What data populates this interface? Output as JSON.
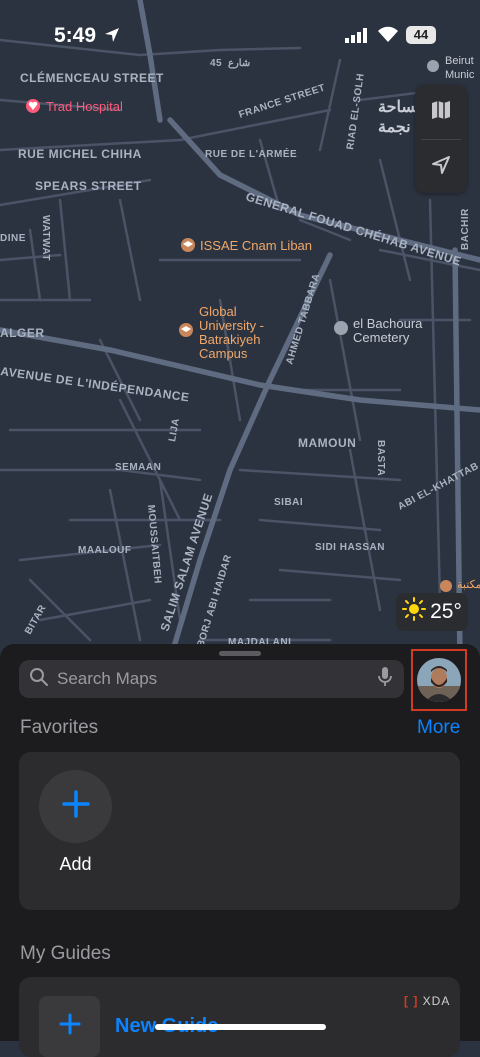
{
  "status_bar": {
    "time": "5:49",
    "battery": "44"
  },
  "map": {
    "pois": [
      {
        "name": "Trad Hospital",
        "type": "hospital"
      },
      {
        "name": "ISSAE Cnam Liban",
        "type": "school"
      },
      {
        "name": "Global University - Batrakiyeh Campus",
        "lines": [
          "Global",
          "University -",
          "Batrakiyeh",
          "Campus"
        ],
        "type": "school"
      },
      {
        "name": "el Bachoura Cemetery",
        "lines": [
          "el Bachoura",
          "Cemetery"
        ],
        "type": "cemetery"
      }
    ],
    "edge_texts": [
      "Beirut",
      "Munic",
      "مساحة",
      "نجمة",
      "مكتبة"
    ],
    "streets": [
      "CLÉMENCEAU STREET",
      "FRANCE STREET",
      "RUE DE L'ARMÉE",
      "RUE MICHEL CHIHA",
      "SPEARS STREET",
      "RIAD EL-SOLH",
      "GENERAL FOUAD CHÉHAB AVENUE",
      "WATWAT",
      "ALGER",
      "AVENUE DE L'INDÉPENDANCE",
      "AHMED TABBARA",
      "MAMOUN",
      "BASTA",
      "SEMAAN",
      "MOUSSAITBEH",
      "SALIM SALAM AVENUE",
      "SIBAI",
      "SIDI HASSAN",
      "MAALOUF",
      "BORJ ABI HAIDAR",
      "MAJDALANI",
      "BITAR",
      "LIJA",
      "BACHIR",
      "ABI EL-KHATTAB",
      "DINE",
      "45",
      "شارع"
    ]
  },
  "weather": {
    "temp": "25°",
    "icon": "sun-icon"
  },
  "search": {
    "placeholder": "Search Maps"
  },
  "favorites": {
    "title": "Favorites",
    "more": "More",
    "add_label": "Add"
  },
  "guides": {
    "title": "My Guides",
    "new_label": "New Guide"
  },
  "watermark": "XDA",
  "colors": {
    "accent": "#0a84ff",
    "highlight": "#d33a24",
    "map_bg": "#2c3340",
    "sheet_bg": "#1c1c1e",
    "poi_orange": "#f0a86a",
    "poi_red": "#ff5a7a"
  }
}
